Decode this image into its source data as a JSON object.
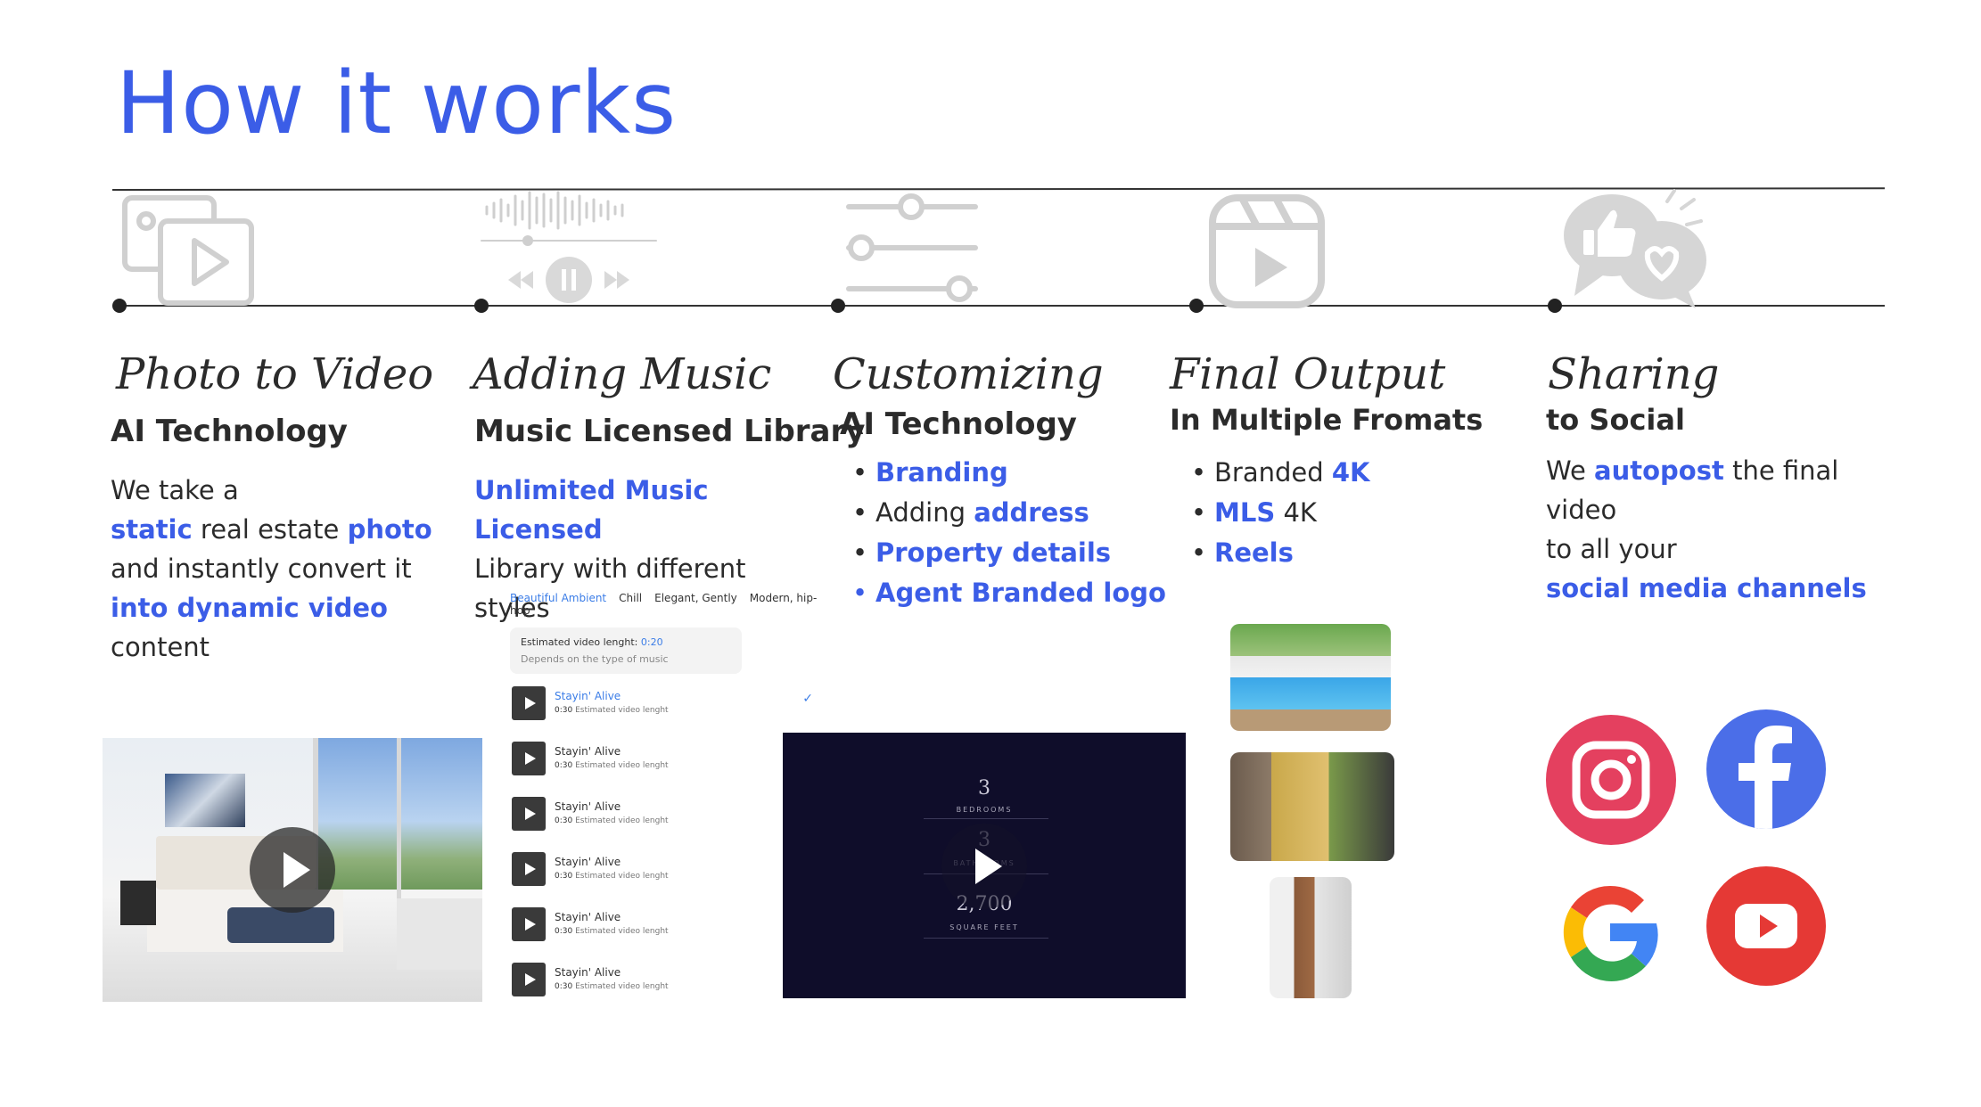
{
  "title": "How it works",
  "steps": [
    {
      "title": "Photo to Video",
      "subtitle": "AI Technology",
      "icon": "photo-video-icon"
    },
    {
      "title": "Adding Music",
      "subtitle": "Music Licensed Library",
      "icon": "music-player-icon"
    },
    {
      "title": "Customizing",
      "subtitle": "AI Technology",
      "icon": "sliders-icon"
    },
    {
      "title": "Final Output",
      "subtitle": "In Multiple Fromats",
      "icon": "reel-play-icon"
    },
    {
      "title": "Sharing",
      "subtitle": "to Social",
      "icon": "social-chat-icon"
    }
  ],
  "step1_body": {
    "l1": "We take a",
    "l2a": "static",
    "l2b": " real estate ",
    "l2c": "photo",
    "l3": "and instantly convert it",
    "l4a": "into dynamic video",
    "l4b": " content"
  },
  "step2_body": {
    "l1": "Unlimited Music Licensed",
    "l2": "Library with different styles"
  },
  "step3_bullets": {
    "b1": "Branding",
    "b2a": "Adding ",
    "b2b": "address",
    "b3": "Property details",
    "b4": "Agent Branded logo"
  },
  "step4_bullets": {
    "b1a": "Branded ",
    "b1b": "4K",
    "b2a": "MLS",
    "b2b": " 4K",
    "b3": "Reels"
  },
  "step5_body": {
    "l1a": "We ",
    "l1b": "autopost",
    "l1c": " the final video",
    "l2": "to all your",
    "l3": "social media channels"
  },
  "music": {
    "tabs": [
      "Beautiful Ambient",
      "Chill",
      "Elegant, Gently",
      "Modern, hip-hop"
    ],
    "est_label": "Estimated video lenght: ",
    "est_value": "0:20",
    "est_note": "Depends on the type of music",
    "track_name": "Stayin' Alive",
    "track_time": "0:30",
    "track_note": "Estimated video lenght"
  },
  "dark_video": {
    "n1": "3",
    "l1": "BEDROOMS",
    "n2": "3",
    "l2": "BATHROOMS",
    "n3": "2,700",
    "l3": "SQUARE FEET"
  },
  "colors": {
    "accent": "#3b5de7",
    "instagram": "#e4405f",
    "facebook": "#4b6ee8",
    "youtube": "#e53935"
  },
  "social": [
    "instagram-icon",
    "facebook-icon",
    "google-icon",
    "youtube-icon"
  ]
}
